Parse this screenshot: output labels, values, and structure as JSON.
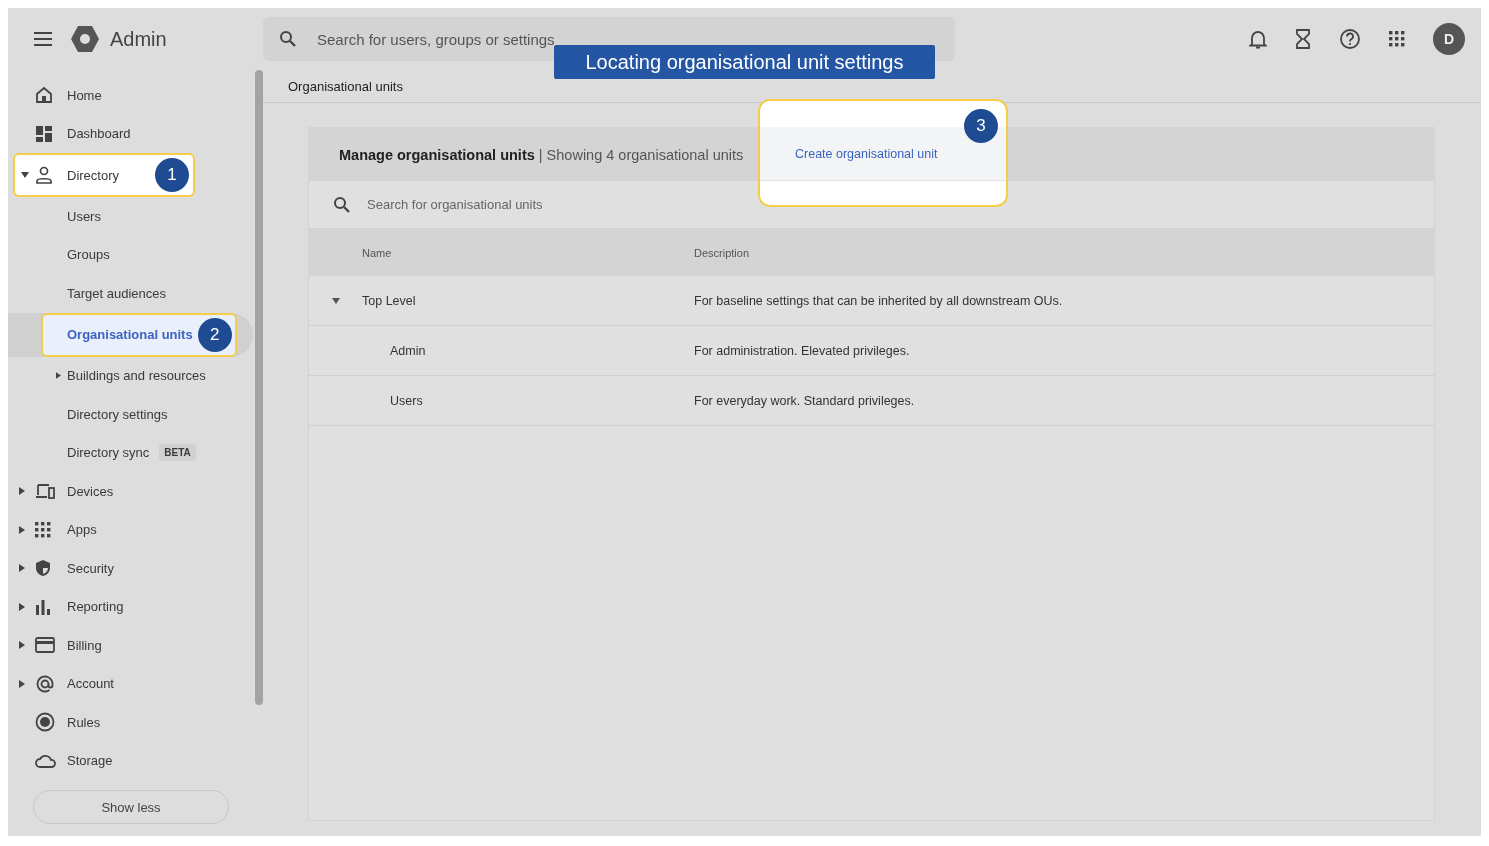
{
  "app": {
    "title": "Admin"
  },
  "search": {
    "placeholder": "Search for users, groups or settings"
  },
  "avatar": {
    "initial": "D"
  },
  "banner": {
    "text": "Locating organisational unit settings"
  },
  "sidebar": {
    "items": [
      {
        "label": "Home",
        "selected": false
      },
      {
        "label": "Dashboard",
        "selected": false
      },
      {
        "label": "Directory",
        "expanded": true,
        "selected": false,
        "step": "1",
        "children": [
          {
            "label": "Users",
            "selected": false
          },
          {
            "label": "Groups",
            "selected": false
          },
          {
            "label": "Target audiences",
            "selected": false
          },
          {
            "label": "Organisational units",
            "selected": true,
            "step": "2"
          },
          {
            "label": "Buildings and resources",
            "expanded": false,
            "selected": false
          },
          {
            "label": "Directory settings",
            "selected": false
          },
          {
            "label": "Directory sync",
            "badge": "BETA",
            "selected": false
          }
        ]
      },
      {
        "label": "Devices",
        "expanded": false,
        "selected": false
      },
      {
        "label": "Apps",
        "expanded": false,
        "selected": false
      },
      {
        "label": "Security",
        "expanded": false,
        "selected": false
      },
      {
        "label": "Reporting",
        "expanded": false,
        "selected": false
      },
      {
        "label": "Billing",
        "expanded": false,
        "selected": false
      },
      {
        "label": "Account",
        "expanded": false,
        "selected": false
      },
      {
        "label": "Rules",
        "selected": false
      },
      {
        "label": "Storage",
        "selected": false
      }
    ],
    "show_less": "Show less"
  },
  "breadcrumb": "Organisational units",
  "card": {
    "heading": "**Manage organisational units** | Showing 4 organisational units",
    "create_button": {
      "label": "Create organisational unit",
      "step": "3"
    },
    "search": {
      "placeholder": "Search for organisational units"
    },
    "table": {
      "columns": [
        "Name",
        "Description"
      ],
      "rows": [
        {
          "name": "Top Level",
          "description": "For baseline settings that can be inherited by all downstream OUs.",
          "expanded": true,
          "children": [
            {
              "name": "Admin",
              "description": "For administration. Elevated privileges."
            },
            {
              "name": "Users",
              "description": "For everyday work. Standard privileges."
            }
          ]
        }
      ]
    }
  }
}
